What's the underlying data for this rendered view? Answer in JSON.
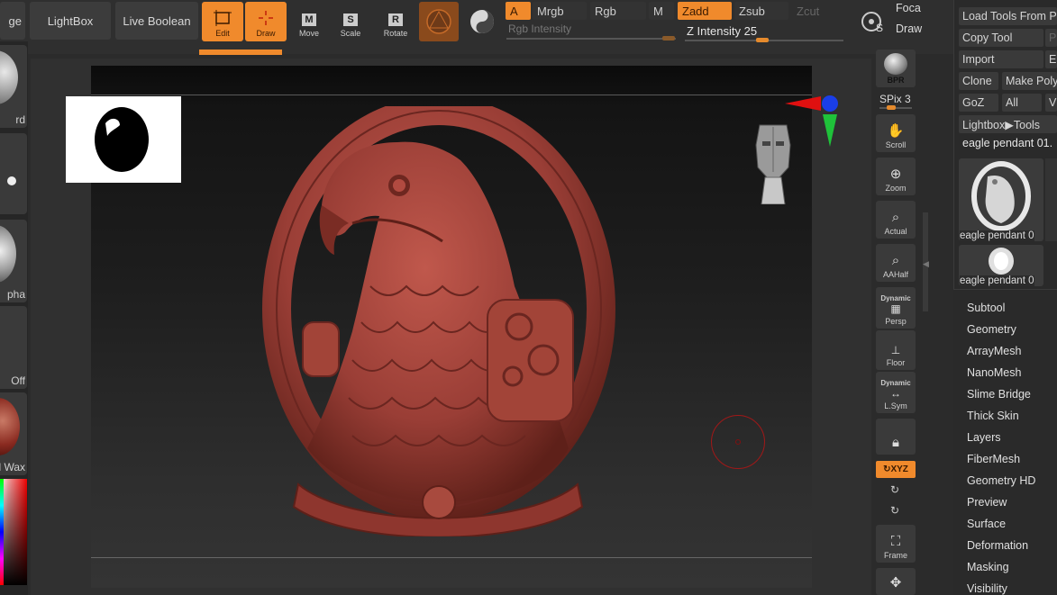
{
  "topbar": {
    "partial_left": "ge",
    "lightbox": "LightBox",
    "live_boolean": "Live Boolean",
    "tools": [
      {
        "key": "edit",
        "label": "Edit",
        "active": true
      },
      {
        "key": "draw",
        "label": "Draw",
        "active": true
      },
      {
        "key": "move",
        "label": "Move",
        "letter": "M",
        "active": false
      },
      {
        "key": "scale",
        "label": "Scale",
        "letter": "S",
        "active": false
      },
      {
        "key": "rotate",
        "label": "Rotate",
        "letter": "R",
        "active": false
      }
    ],
    "a_label": "A",
    "mrgb": "Mrgb",
    "rgb": "Rgb",
    "m": "M",
    "zadd": "Zadd",
    "zsub": "Zsub",
    "zcut": "Zcut",
    "rgb_intensity": "Rgb Intensity",
    "z_intensity_label": "Z Intensity",
    "z_intensity_value": "25",
    "focal": "Foca",
    "draw_partial": "Draw",
    "s_letter": "S"
  },
  "left_strip": {
    "items": [
      "rd",
      "pha",
      "Off",
      "d Wax"
    ]
  },
  "right_bar": {
    "bpr": "BPR",
    "spix_label": "SPix",
    "spix_value": "3",
    "buttons": [
      {
        "key": "scroll",
        "label": "Scroll"
      },
      {
        "key": "zoom",
        "label": "Zoom"
      },
      {
        "key": "actual",
        "label": "Actual"
      },
      {
        "key": "aahalf",
        "label": "AAHalf"
      }
    ],
    "persp_top": "Dynamic",
    "persp": "Persp",
    "floor": "Floor",
    "lsym_top": "Dynamic",
    "lsym": "L.Sym",
    "xyz": "XYZ",
    "frame": "Frame"
  },
  "tool_panel": {
    "load_tools": "Load Tools From P",
    "copy_tool": "Copy Tool",
    "paste_partial": "P",
    "import": "Import",
    "export_partial": "E",
    "clone": "Clone",
    "make_poly": "Make Poly",
    "goz": "GoZ",
    "all": "All",
    "visible_partial": "V",
    "lightbox_tools": "Lightbox▶Tools",
    "current_tool": "eagle pendant 01.",
    "thumb1_label": "eagle pendant 0",
    "thumb2_label": "eagle pendant 0",
    "menu": [
      "Subtool",
      "Geometry",
      "ArrayMesh",
      "NanoMesh",
      "Slime Bridge",
      "Thick Skin",
      "Layers",
      "FiberMesh",
      "Geometry HD",
      "Preview",
      "Surface",
      "Deformation",
      "Masking",
      "Visibility"
    ]
  },
  "colors": {
    "accent": "#f08a2c",
    "model": "#9a3e36",
    "axis_x": "#e01010",
    "axis_y": "#1fc23a",
    "axis_z": "#1a3ee8"
  }
}
